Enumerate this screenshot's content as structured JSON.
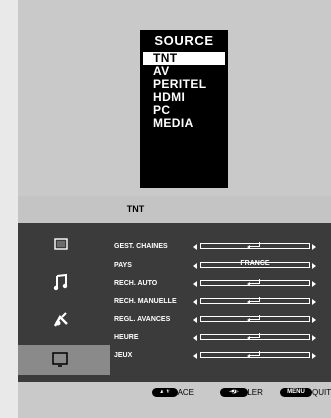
{
  "source": {
    "title": "SOURCE",
    "items": [
      "TNT",
      "AV",
      "PERITEL",
      "HDMI",
      "PC",
      "MEDIA"
    ],
    "selected_index": 0
  },
  "menu": {
    "title": "TNT",
    "side_icons": [
      "picture-icon",
      "music-icon",
      "settings-icon",
      "tv-icon"
    ],
    "selected_side_icon": "tv-icon",
    "rows": [
      {
        "label": "GEST. CHAINES",
        "value": ""
      },
      {
        "label": "PAYS",
        "value": "FRANCE"
      },
      {
        "label": "RECH. AUTO",
        "value": ""
      },
      {
        "label": "RECH. MANUELLE",
        "value": ""
      },
      {
        "label": "REGL. AVANCES",
        "value": ""
      },
      {
        "label": "HEURE",
        "value": ""
      },
      {
        "label": "JEUX",
        "value": ""
      }
    ]
  },
  "footer": {
    "move_label": "DPLACE",
    "adjust_label": "REGLER",
    "menu_button": "MENU",
    "quit_label": "QUITTER"
  }
}
